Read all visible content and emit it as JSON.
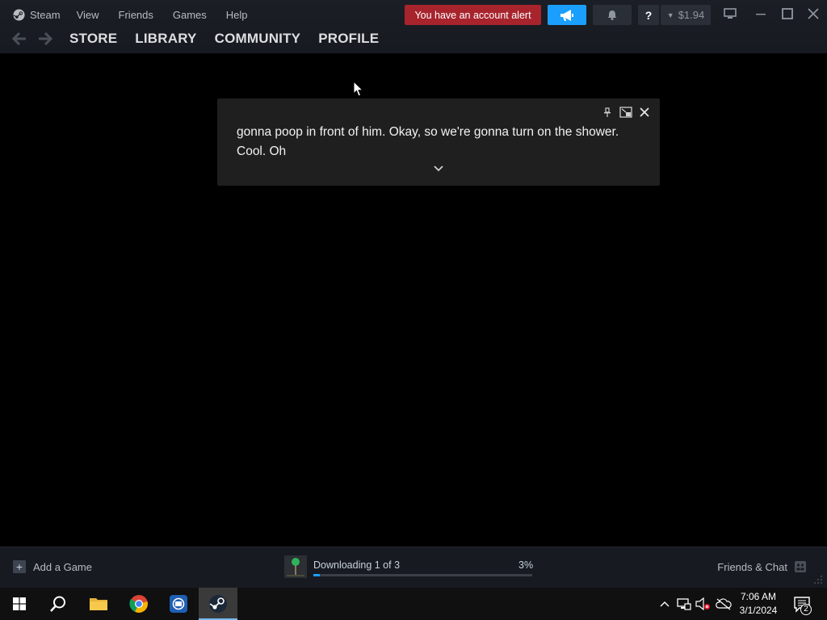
{
  "menu": {
    "steam": "Steam",
    "view": "View",
    "friends": "Friends",
    "games": "Games",
    "help": "Help"
  },
  "nav": {
    "back_icon": "arrow-left-icon",
    "forward_icon": "arrow-right-icon",
    "store": "STORE",
    "library": "LIBRARY",
    "community": "COMMUNITY",
    "profile": "PROFILE"
  },
  "header": {
    "account_alert": "You have an account alert",
    "help_label": "?",
    "wallet_balance": "$1.94"
  },
  "caption": {
    "text": "gonna poop in front of him. Okay, so we're gonna turn on the shower. Cool. Oh"
  },
  "bottom_bar": {
    "add_game": "Add a Game",
    "download_status": "Downloading 1 of 3",
    "download_percent_label": "3%",
    "download_progress": 0.03,
    "friends_chat": "Friends & Chat"
  },
  "taskbar": {
    "time": "7:06 AM",
    "date": "3/1/2024",
    "notification_count": "2"
  },
  "colors": {
    "alert_red": "#a8242d",
    "accent_blue": "#1a9fff",
    "titlebar": "#171a21",
    "caption_bg": "#1f1f1f"
  }
}
